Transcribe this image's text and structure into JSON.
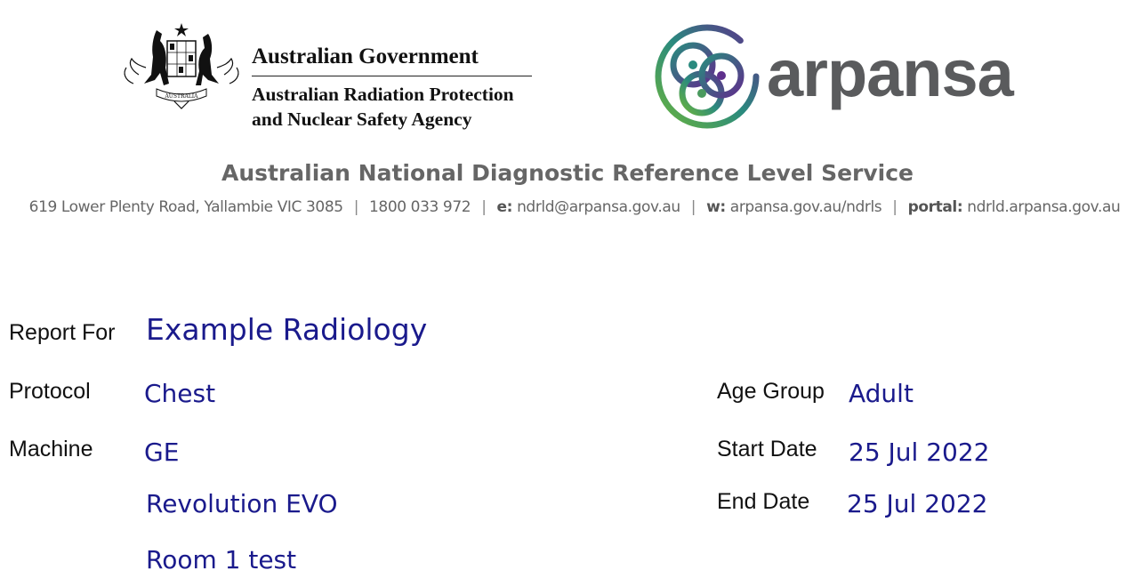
{
  "header": {
    "gov_title": "Australian Government",
    "agency_line1": "Australian Radiation Protection",
    "agency_line2": "and Nuclear Safety Agency",
    "coat_of_arms_icon": "coat-of-arms-icon",
    "crest_banner_text": "AUSTRALIA",
    "brand_logo_icon": "arpansa-knot-logo-icon",
    "brand_name": "arpansa",
    "brand_colors": [
      "#5e2f8c",
      "#2a8a7e",
      "#6ab43e"
    ],
    "brand_text_color": "#5a5b5d"
  },
  "service": {
    "title": "Australian National Diagnostic Reference Level Service",
    "address": "619 Lower Plenty Road, Yallambie VIC 3085",
    "phone": "1800 033 972",
    "email_label": "e:",
    "email": "ndrld@arpansa.gov.au",
    "web_label": "w:",
    "web": "arpansa.gov.au/ndrls",
    "portal_label": "portal:",
    "portal": "ndrld.arpansa.gov.au",
    "separator": "|"
  },
  "report": {
    "report_for_label": "Report For",
    "report_for_value": "Example Radiology",
    "protocol_label": "Protocol",
    "protocol_value": "Chest",
    "machine_label": "Machine",
    "machine_make": "GE",
    "machine_model": "Revolution EVO",
    "machine_room": "Room 1 test",
    "age_group_label": "Age Group",
    "age_group_value": "Adult",
    "start_date_label": "Start Date",
    "start_date_value": "25 Jul 2022",
    "end_date_label": "End Date",
    "end_date_value": "25 Jul 2022"
  },
  "colors": {
    "value_text": "#1a1a8c",
    "header_gray": "#666666"
  }
}
